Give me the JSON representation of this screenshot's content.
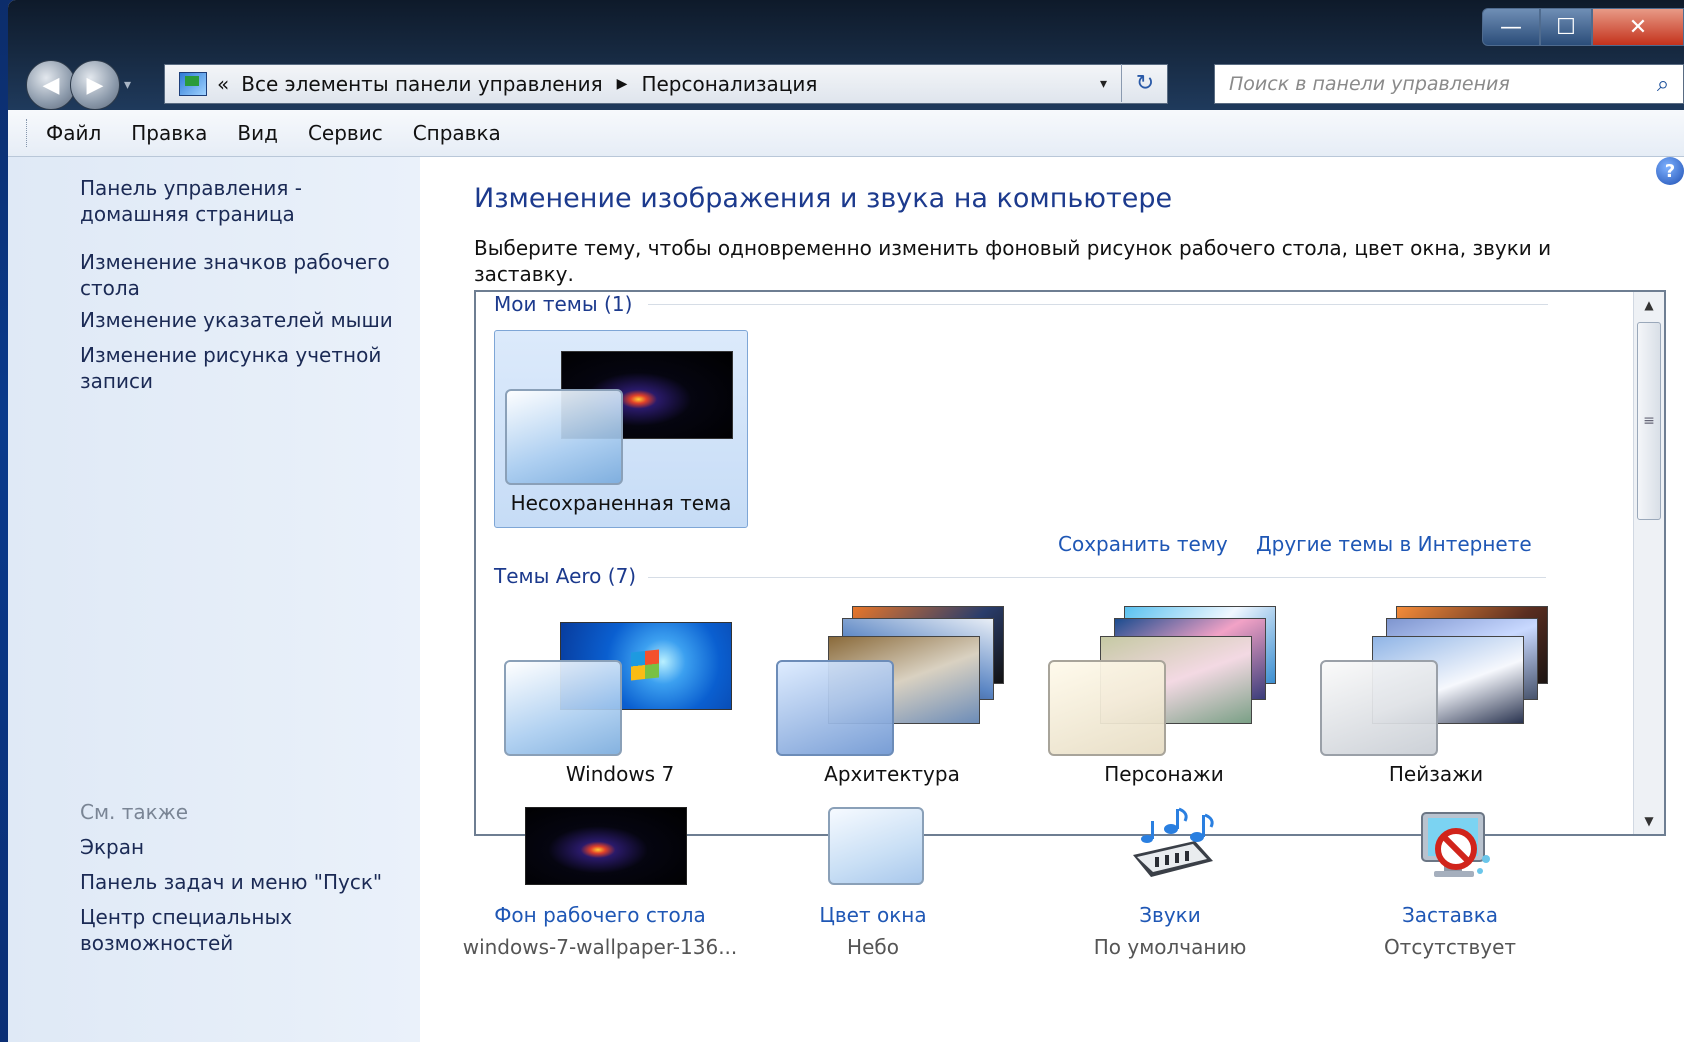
{
  "window": {
    "controls": {
      "minimize": "—",
      "maximize": "☐",
      "close": "✕"
    }
  },
  "nav": {
    "back": "◀",
    "forward": "▶",
    "history_dropdown": "▾"
  },
  "address": {
    "prefix": "«",
    "crumbs": [
      "Все элементы панели управления",
      "Персонализация"
    ],
    "separator": "▶",
    "dropdown": "▾",
    "refresh": "↻"
  },
  "search": {
    "placeholder": "Поиск в панели управления",
    "icon": "⌕"
  },
  "menu": [
    "Файл",
    "Правка",
    "Вид",
    "Сервис",
    "Справка"
  ],
  "left": {
    "links": [
      "Панель управления - домашняя страница",
      "Изменение значков рабочего стола",
      "Изменение указателей мыши",
      "Изменение рисунка учетной записи"
    ],
    "see_also_title": "См. также",
    "see_also": [
      "Экран",
      "Панель задач и меню \"Пуск\"",
      "Центр специальных возможностей"
    ]
  },
  "main": {
    "help": "?",
    "title": "Изменение изображения и звука на компьютере",
    "description": "Выберите тему, чтобы одновременно изменить фоновый рисунок рабочего стола, цвет окна, звуки и заставку.",
    "my_themes_title": "Мои темы (1)",
    "my_themes": [
      {
        "name": "Несохраненная тема",
        "selected": true
      }
    ],
    "save_theme": "Сохранить тему",
    "more_themes": "Другие темы в Интернете",
    "aero_title": "Темы Aero (7)",
    "aero_themes": [
      "Windows 7",
      "Архитектура",
      "Персонажи",
      "Пейзажи"
    ],
    "scroll": {
      "up": "▲",
      "down": "▼",
      "grip": "≡"
    }
  },
  "bottom": [
    {
      "label": "Фон рабочего стола",
      "value": "windows-7-wallpaper-136..."
    },
    {
      "label": "Цвет окна",
      "value": "Небо"
    },
    {
      "label": "Звуки",
      "value": "По умолчанию"
    },
    {
      "label": "Заставка",
      "value": "Отсутствует"
    }
  ],
  "colors": {
    "link": "#1f57b5",
    "title": "#1c3a8d",
    "accent_close": "#c4321c"
  }
}
